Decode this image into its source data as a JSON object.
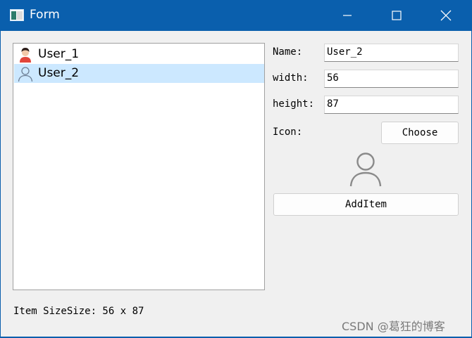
{
  "window": {
    "title": "Form"
  },
  "list": {
    "items": [
      {
        "label": "User_1",
        "icon": "user-avatar-red-icon",
        "selected": false
      },
      {
        "label": "User_2",
        "icon": "user-outline-icon",
        "selected": true
      }
    ]
  },
  "form": {
    "name_label": "Name:",
    "name_value": "User_2",
    "width_label": "width:",
    "width_value": "56",
    "height_label": "height:",
    "height_value": "87",
    "icon_label": "Icon:",
    "choose_label": "Choose",
    "preview_icon": "user-outline-icon",
    "add_item_label": "AddItem"
  },
  "status": {
    "text": "Item SizeSize: 56 x 87"
  },
  "watermark": "CSDN @葛狂的博客",
  "colors": {
    "titlebar": "#0a5fad",
    "selection": "#cce8ff",
    "client_bg": "#f0f0f0"
  }
}
